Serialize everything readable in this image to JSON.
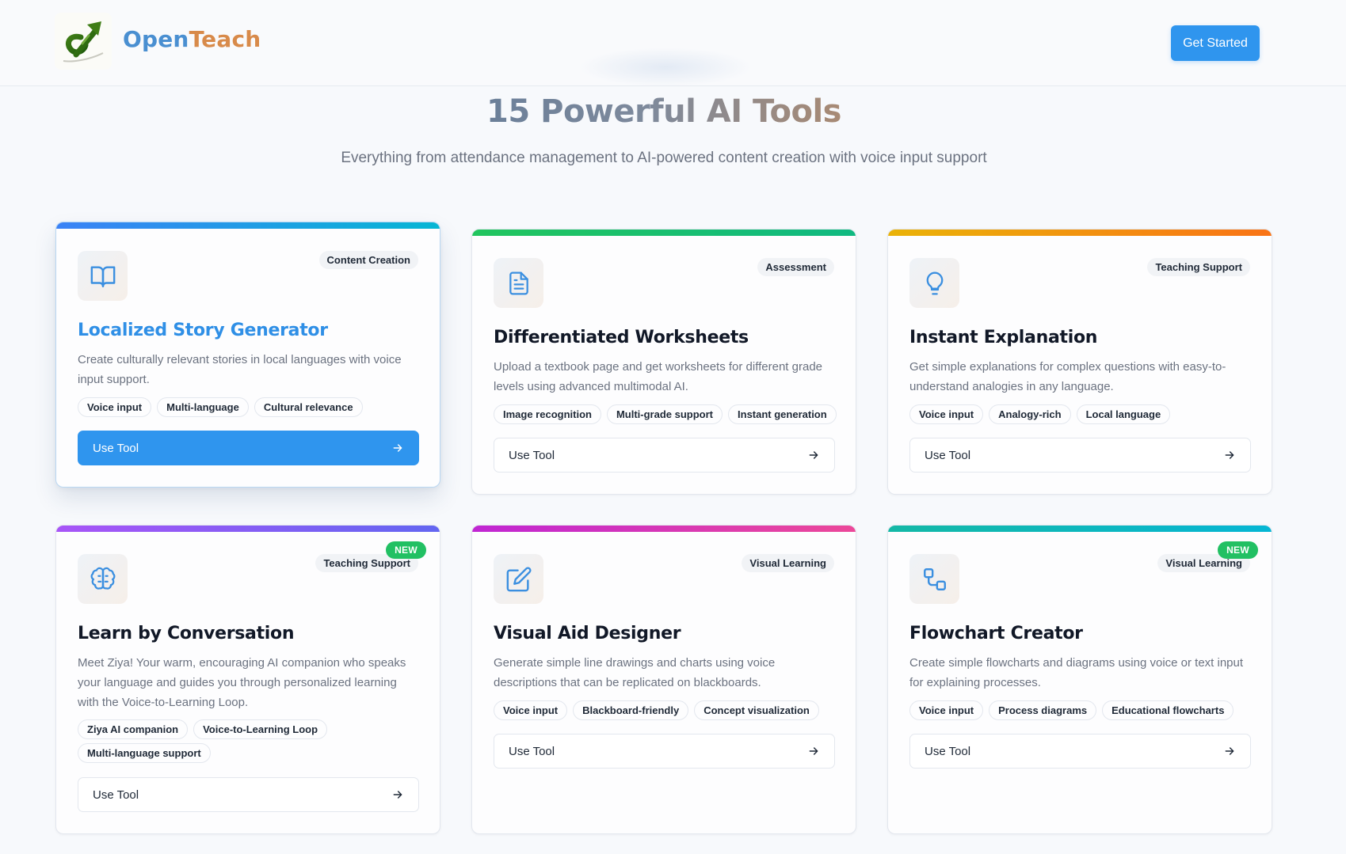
{
  "header": {
    "brand_part1": "Open",
    "brand_part2": "Teach",
    "cta_label": "Get Started",
    "logo_icon": "rising-arrow-logo-icon"
  },
  "hero": {
    "title": "15 Powerful AI Tools",
    "subtitle": "Everything from attendance management to AI-powered content creation with voice input support"
  },
  "colors": {
    "primary": "#2f95ee",
    "new_badge": "#22c063"
  },
  "cards": [
    {
      "title": "Localized Story Generator",
      "category": "Content Creation",
      "description": "Create culturally relevant stories in local languages with voice input support.",
      "tags": [
        "Voice input",
        "Multi-language",
        "Cultural relevance"
      ],
      "button_label": "Use Tool",
      "icon": "book-open-icon",
      "is_new": false,
      "is_active": true
    },
    {
      "title": "Differentiated Worksheets",
      "category": "Assessment",
      "description": "Upload a textbook page and get worksheets for different grade levels using advanced multimodal AI.",
      "tags": [
        "Image recognition",
        "Multi-grade support",
        "Instant generation"
      ],
      "button_label": "Use Tool",
      "icon": "document-icon",
      "is_new": false
    },
    {
      "title": "Instant Explanation",
      "category": "Teaching Support",
      "description": "Get simple explanations for complex questions with easy-to-understand analogies in any language.",
      "tags": [
        "Voice input",
        "Analogy-rich",
        "Local language"
      ],
      "button_label": "Use Tool",
      "icon": "lightbulb-icon",
      "is_new": false
    },
    {
      "title": "Learn by Conversation",
      "category": "Teaching Support",
      "description": "Meet Ziya! Your warm, encouraging AI companion who speaks your language and guides you through personalized learning with the Voice-to-Learning Loop.",
      "tags": [
        "Ziya AI companion",
        "Voice-to-Learning Loop",
        "Multi-language support"
      ],
      "button_label": "Use Tool",
      "icon": "brain-icon",
      "is_new": true,
      "new_label": "NEW"
    },
    {
      "title": "Visual Aid Designer",
      "category": "Visual Learning",
      "description": "Generate simple line drawings and charts using voice descriptions that can be replicated on blackboards.",
      "tags": [
        "Voice input",
        "Blackboard-friendly",
        "Concept visualization"
      ],
      "button_label": "Use Tool",
      "icon": "pencil-square-icon",
      "is_new": false
    },
    {
      "title": "Flowchart Creator",
      "category": "Visual Learning",
      "description": "Create simple flowcharts and diagrams using voice or text input for explaining processes.",
      "tags": [
        "Voice input",
        "Process diagrams",
        "Educational flowcharts"
      ],
      "button_label": "Use Tool",
      "icon": "flowchart-icon",
      "is_new": true,
      "new_label": "NEW"
    }
  ]
}
